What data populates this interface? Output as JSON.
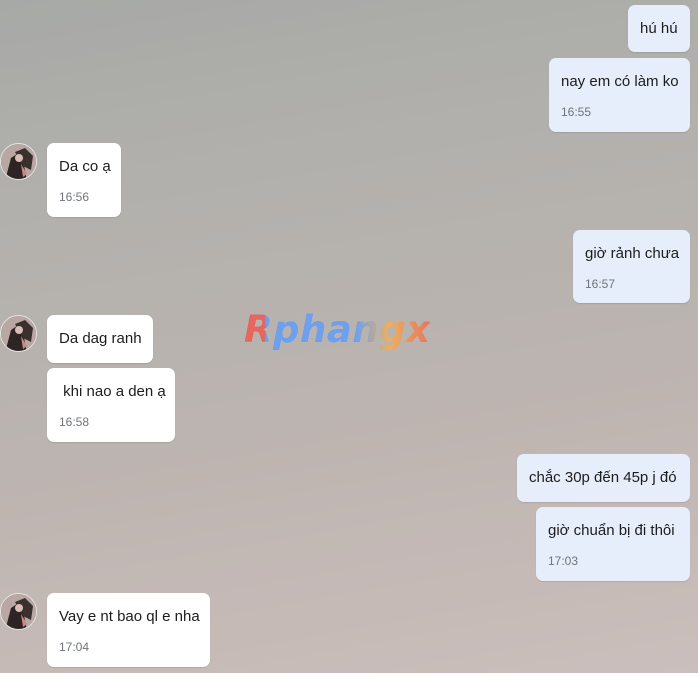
{
  "watermark": "Rphangx",
  "colors": {
    "sent_bubble": "#e6eefb",
    "received_bubble": "#ffffff",
    "timestamp": "#6f747a"
  },
  "messages": [
    {
      "from": "me",
      "text": "hú hú",
      "time": ""
    },
    {
      "from": "me",
      "text": "nay em có làm ko",
      "time": "16:55"
    },
    {
      "from": "contact",
      "text": "Da co ạ",
      "time": "16:56"
    },
    {
      "from": "me",
      "text": "giờ rảnh chưa",
      "time": "16:57"
    },
    {
      "from": "contact",
      "text": "Da dag ranh",
      "time": ""
    },
    {
      "from": "contact",
      "text": " khi nao a den ạ",
      "time": "16:58"
    },
    {
      "from": "me",
      "text": "chắc 30p đến 45p j đó",
      "time": ""
    },
    {
      "from": "me",
      "text": "giờ chuẩn bị đi thôi",
      "time": "17:03"
    },
    {
      "from": "contact",
      "text": "Vay e nt bao ql e nha",
      "time": "17:04"
    }
  ]
}
